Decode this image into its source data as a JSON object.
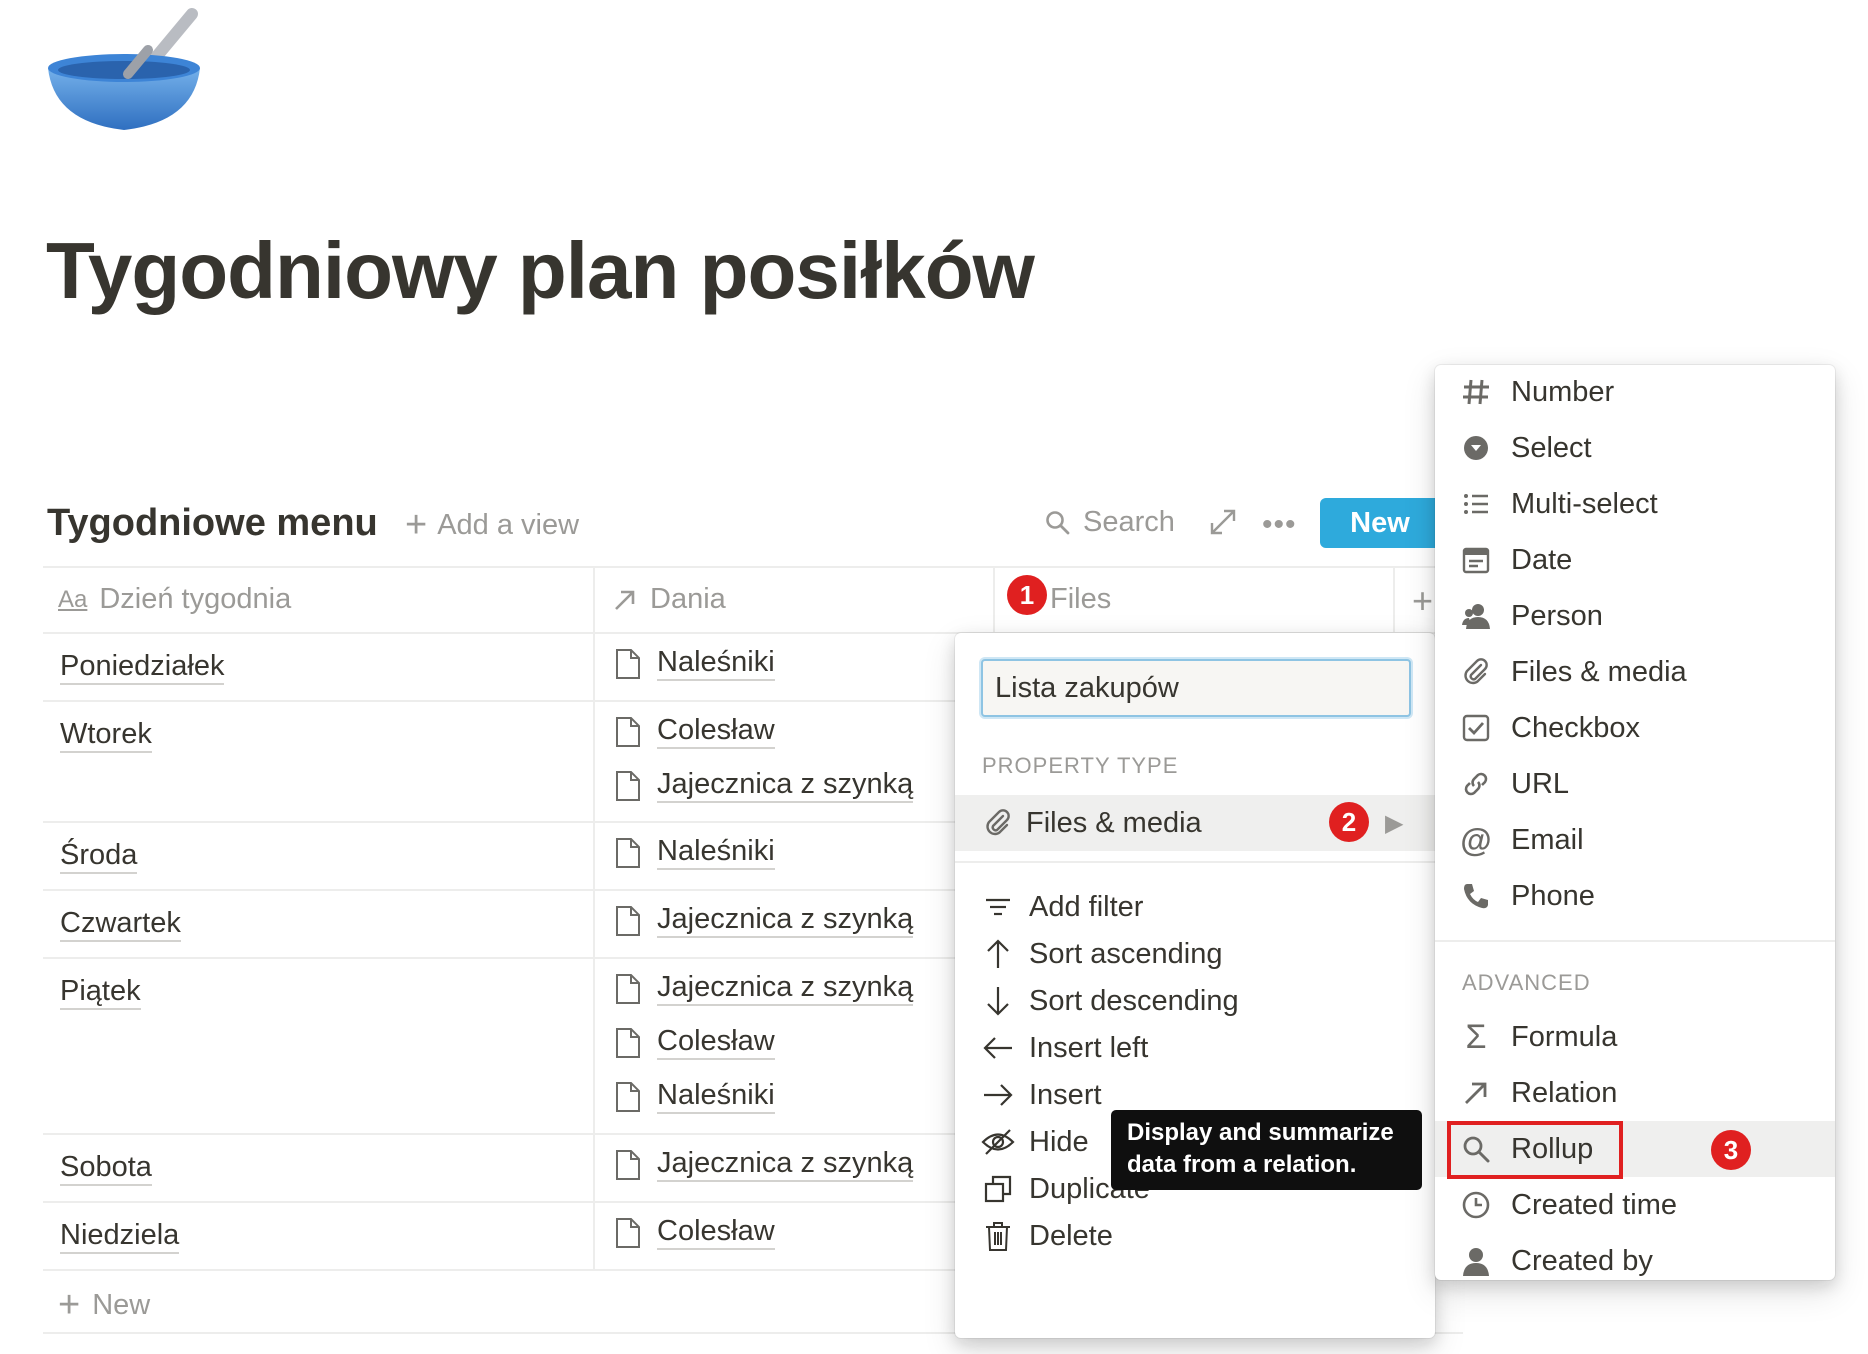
{
  "page": {
    "icon": "bowl-with-spoon-icon",
    "title": "Tygodniowy plan posiłków"
  },
  "database": {
    "title": "Tygodniowe menu",
    "add_view": "Add a view",
    "search": "Search",
    "new_button": "New",
    "add_row": "New"
  },
  "columns": [
    {
      "label": "Dzień tygodnia",
      "icon": "title-aa-icon"
    },
    {
      "label": "Dania",
      "icon": "relation-arrow-icon"
    },
    {
      "label": "Files",
      "icon": ""
    }
  ],
  "rows": [
    {
      "day": "Poniedziałek",
      "dishes": [
        "Naleśniki"
      ]
    },
    {
      "day": "Wtorek",
      "dishes": [
        "Colesław",
        "Jajecznica z szynką"
      ]
    },
    {
      "day": "Środa",
      "dishes": [
        "Naleśniki"
      ]
    },
    {
      "day": "Czwartek",
      "dishes": [
        "Jajecznica z szynką"
      ]
    },
    {
      "day": "Piątek",
      "dishes": [
        "Jajecznica z szynką",
        "Colesław",
        "Naleśniki"
      ]
    },
    {
      "day": "Sobota",
      "dishes": [
        "Jajecznica z szynką"
      ]
    },
    {
      "day": "Niedziela",
      "dishes": [
        "Colesław"
      ]
    }
  ],
  "badges": [
    "1",
    "2",
    "3"
  ],
  "property_menu": {
    "name_value": "Lista zakupów",
    "section_label": "PROPERTY TYPE",
    "current_type": "Files & media",
    "items": [
      {
        "label": "Add filter",
        "icon": "filter-icon"
      },
      {
        "label": "Sort ascending",
        "icon": "arrow-up-icon"
      },
      {
        "label": "Sort descending",
        "icon": "arrow-down-icon"
      },
      {
        "label": "Insert left",
        "icon": "arrow-left-icon"
      },
      {
        "label": "Insert",
        "icon": "arrow-right-icon"
      },
      {
        "label": "Hide",
        "icon": "eye-slash-icon"
      },
      {
        "label": "Duplicate",
        "icon": "duplicate-icon"
      },
      {
        "label": "Delete",
        "icon": "trash-icon"
      }
    ]
  },
  "tooltip": {
    "line1": "Display and summarize",
    "line2": "data from a relation."
  },
  "type_menu": {
    "basic": [
      {
        "label": "Number",
        "icon": "hash-icon"
      },
      {
        "label": "Select",
        "icon": "select-icon"
      },
      {
        "label": "Multi-select",
        "icon": "list-icon"
      },
      {
        "label": "Date",
        "icon": "calendar-icon"
      },
      {
        "label": "Person",
        "icon": "person-icon"
      },
      {
        "label": "Files & media",
        "icon": "paperclip-icon"
      },
      {
        "label": "Checkbox",
        "icon": "checkbox-icon"
      },
      {
        "label": "URL",
        "icon": "link-icon"
      },
      {
        "label": "Email",
        "icon": "at-icon"
      },
      {
        "label": "Phone",
        "icon": "phone-icon"
      }
    ],
    "advanced_label": "ADVANCED",
    "advanced": [
      {
        "label": "Formula",
        "icon": "sigma-icon"
      },
      {
        "label": "Relation",
        "icon": "relation-arrow-icon"
      },
      {
        "label": "Rollup",
        "icon": "search-icon"
      },
      {
        "label": "Created time",
        "icon": "clock-icon"
      },
      {
        "label": "Created by",
        "icon": "person-icon"
      }
    ]
  },
  "colors": {
    "accent": "#2eaadc",
    "badge": "#e02020",
    "text": "#37352f",
    "muted": "#9b9a97"
  }
}
